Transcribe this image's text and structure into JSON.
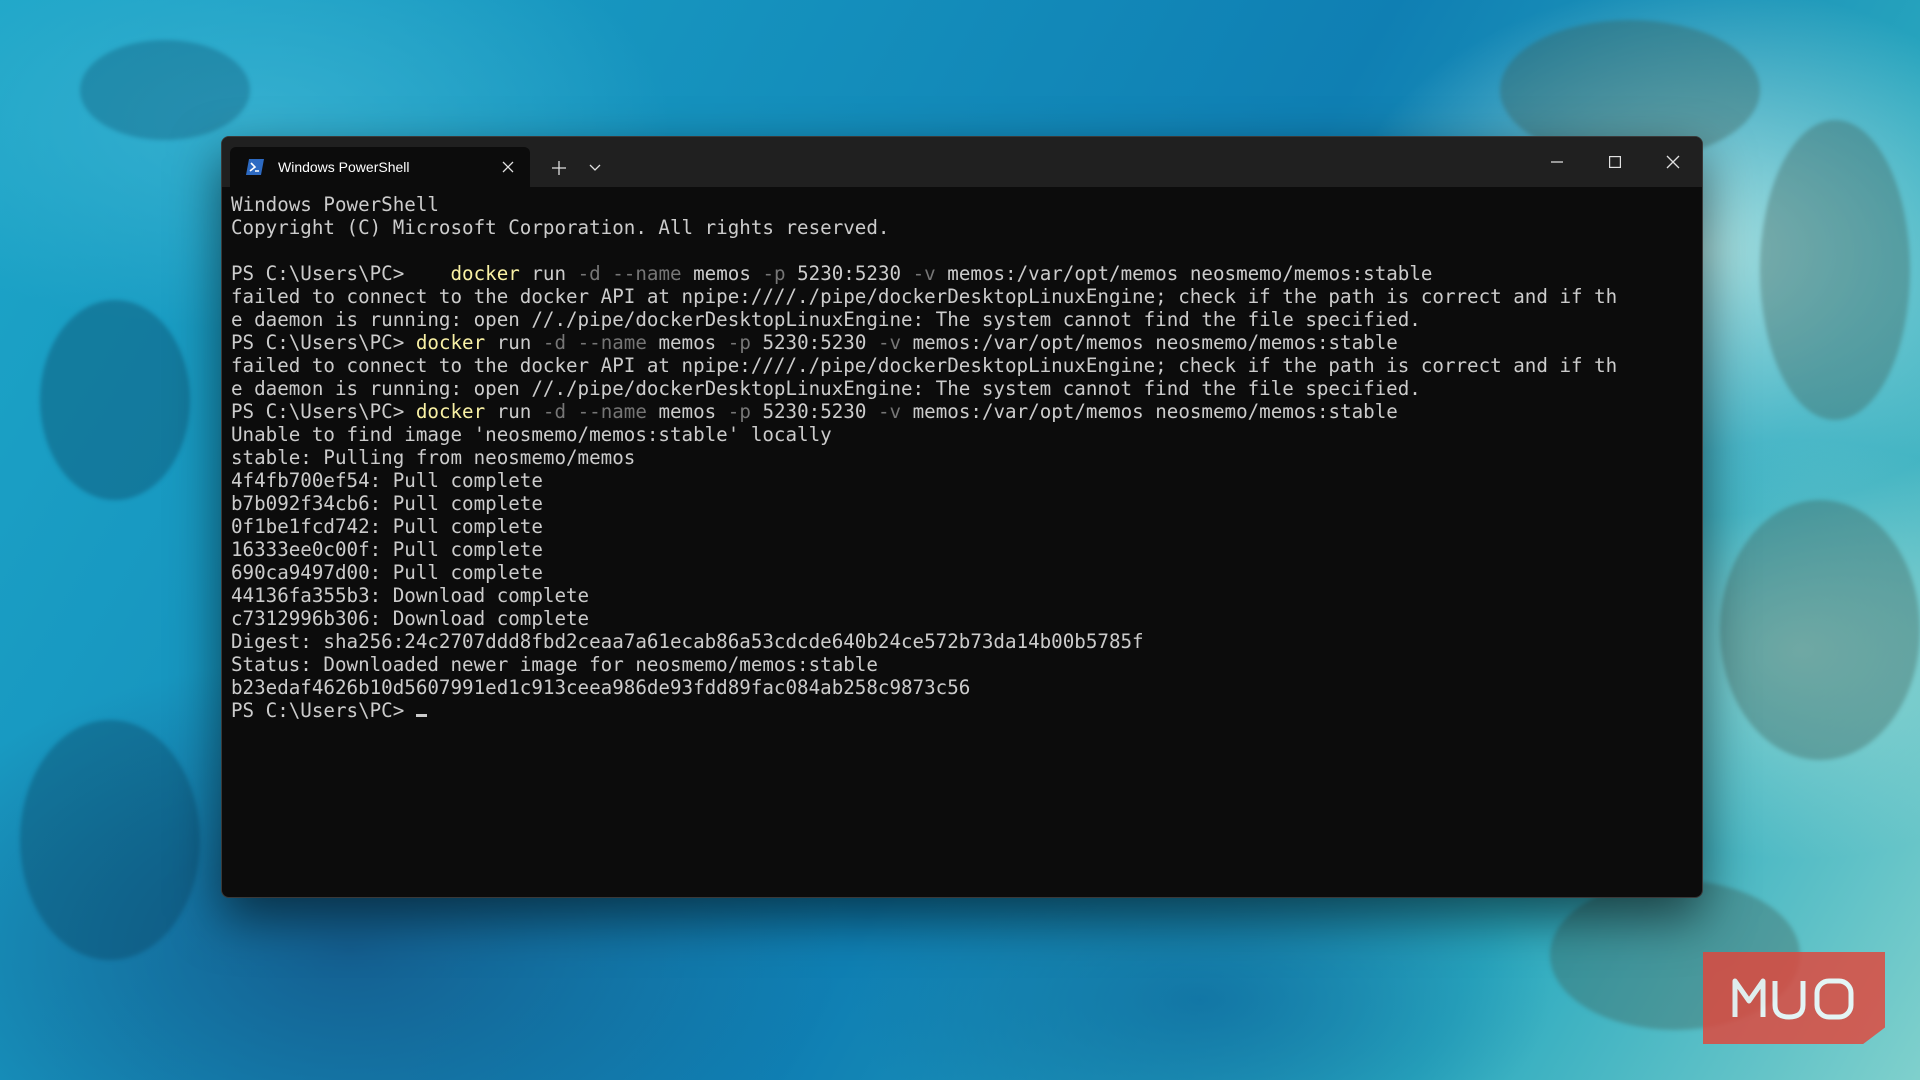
{
  "titlebar": {
    "tab_title": "Windows PowerShell"
  },
  "console": {
    "lines": [
      {
        "segments": [
          {
            "t": "Windows PowerShell",
            "c": "out"
          }
        ]
      },
      {
        "segments": [
          {
            "t": "Copyright (C) Microsoft Corporation. All rights reserved.",
            "c": "out"
          }
        ]
      },
      {
        "segments": []
      },
      {
        "segments": [
          {
            "t": "PS C:\\Users\\PC>    ",
            "c": "out"
          },
          {
            "t": "docker",
            "c": "cmd"
          },
          {
            "t": " run ",
            "c": "out"
          },
          {
            "t": "-d",
            "c": "param"
          },
          {
            "t": " ",
            "c": "out"
          },
          {
            "t": "--name",
            "c": "param"
          },
          {
            "t": " memos ",
            "c": "out"
          },
          {
            "t": "-p",
            "c": "param"
          },
          {
            "t": " 5230:5230 ",
            "c": "out"
          },
          {
            "t": "-v",
            "c": "param"
          },
          {
            "t": " memos:/var/opt/memos neosmemo/memos:stable",
            "c": "out"
          }
        ]
      },
      {
        "segments": [
          {
            "t": "failed to connect to the docker API at npipe:////./pipe/dockerDesktopLinuxEngine; check if the path is correct and if th",
            "c": "out"
          }
        ]
      },
      {
        "segments": [
          {
            "t": "e daemon is running: open //./pipe/dockerDesktopLinuxEngine: The system cannot find the file specified.",
            "c": "out"
          }
        ]
      },
      {
        "segments": [
          {
            "t": "PS C:\\Users\\PC> ",
            "c": "out"
          },
          {
            "t": "docker",
            "c": "cmd"
          },
          {
            "t": " run ",
            "c": "out"
          },
          {
            "t": "-d",
            "c": "param"
          },
          {
            "t": " ",
            "c": "out"
          },
          {
            "t": "--name",
            "c": "param"
          },
          {
            "t": " memos ",
            "c": "out"
          },
          {
            "t": "-p",
            "c": "param"
          },
          {
            "t": " 5230:5230 ",
            "c": "out"
          },
          {
            "t": "-v",
            "c": "param"
          },
          {
            "t": " memos:/var/opt/memos neosmemo/memos:stable",
            "c": "out"
          }
        ]
      },
      {
        "segments": [
          {
            "t": "failed to connect to the docker API at npipe:////./pipe/dockerDesktopLinuxEngine; check if the path is correct and if th",
            "c": "out"
          }
        ]
      },
      {
        "segments": [
          {
            "t": "e daemon is running: open //./pipe/dockerDesktopLinuxEngine: The system cannot find the file specified.",
            "c": "out"
          }
        ]
      },
      {
        "segments": [
          {
            "t": "PS C:\\Users\\PC> ",
            "c": "out"
          },
          {
            "t": "docker",
            "c": "cmd"
          },
          {
            "t": " run ",
            "c": "out"
          },
          {
            "t": "-d",
            "c": "param"
          },
          {
            "t": " ",
            "c": "out"
          },
          {
            "t": "--name",
            "c": "param"
          },
          {
            "t": " memos ",
            "c": "out"
          },
          {
            "t": "-p",
            "c": "param"
          },
          {
            "t": " 5230:5230 ",
            "c": "out"
          },
          {
            "t": "-v",
            "c": "param"
          },
          {
            "t": " memos:/var/opt/memos neosmemo/memos:stable",
            "c": "out"
          }
        ]
      },
      {
        "segments": [
          {
            "t": "Unable to find image 'neosmemo/memos:stable' locally",
            "c": "out"
          }
        ]
      },
      {
        "segments": [
          {
            "t": "stable: Pulling from neosmemo/memos",
            "c": "out"
          }
        ]
      },
      {
        "segments": [
          {
            "t": "4f4fb700ef54: Pull complete",
            "c": "out"
          }
        ]
      },
      {
        "segments": [
          {
            "t": "b7b092f34cb6: Pull complete",
            "c": "out"
          }
        ]
      },
      {
        "segments": [
          {
            "t": "0f1be1fcd742: Pull complete",
            "c": "out"
          }
        ]
      },
      {
        "segments": [
          {
            "t": "16333ee0c00f: Pull complete",
            "c": "out"
          }
        ]
      },
      {
        "segments": [
          {
            "t": "690ca9497d00: Pull complete",
            "c": "out"
          }
        ]
      },
      {
        "segments": [
          {
            "t": "44136fa355b3: Download complete",
            "c": "out"
          }
        ]
      },
      {
        "segments": [
          {
            "t": "c7312996b306: Download complete",
            "c": "out"
          }
        ]
      },
      {
        "segments": [
          {
            "t": "Digest: sha256:24c2707ddd8fbd2ceaa7a61ecab86a53cdcde640b24ce572b73da14b00b5785f",
            "c": "out"
          }
        ]
      },
      {
        "segments": [
          {
            "t": "Status: Downloaded newer image for neosmemo/memos:stable",
            "c": "out"
          }
        ]
      },
      {
        "segments": [
          {
            "t": "b23edaf4626b10d5607991ed1c913ceea986de93fdd89fac084ab258c9873c56",
            "c": "out"
          }
        ]
      },
      {
        "segments": [
          {
            "t": "PS C:\\Users\\PC> ",
            "c": "out"
          }
        ],
        "cursor": true
      }
    ]
  },
  "watermark": {
    "text": "MUO"
  },
  "colors": {
    "command": "#f9f1a5",
    "parameter": "#767676",
    "output": "#cccccc",
    "console_bg": "#0c0c0c",
    "titlebar_bg": "#202020",
    "logo_bg": "#e2463b"
  },
  "icons": {
    "tab": "powershell-icon",
    "tab_close": "close-icon",
    "new_tab": "plus-icon",
    "dropdown": "chevron-down-icon",
    "minimize": "minimize-icon",
    "maximize": "maximize-icon",
    "close": "close-icon"
  }
}
